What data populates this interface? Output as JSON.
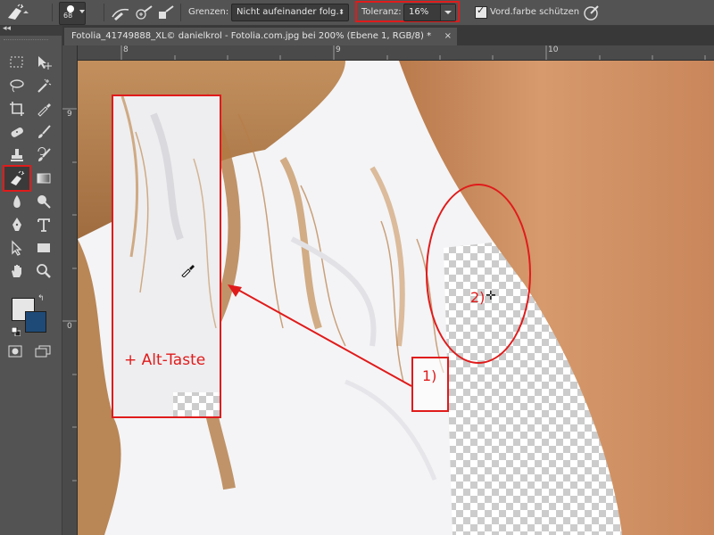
{
  "options_bar": {
    "brush_size": "68",
    "grenzen_label": "Grenzen:",
    "grenzen_value": "Nicht aufeinander folg.",
    "toleranz_label": "Toleranz:",
    "toleranz_value": "16%",
    "protect_fg_label": "Vord.farbe schützen",
    "protect_fg_checked": true
  },
  "document_tab": {
    "title": "Fotolia_41749888_XL© danielkrol - Fotolia.com.jpg bei 200% (Ebene 1, RGB/8) *",
    "close_symbol": "×"
  },
  "panel_collapse_symbol": "◂◂",
  "rulers": {
    "horizontal": [
      "8",
      "9",
      "10"
    ],
    "vertical": [
      "9",
      "0"
    ]
  },
  "toolbar": {
    "tools": [
      "marquee-icon",
      "move-icon",
      "lasso-icon",
      "magic-wand-icon",
      "crop-icon",
      "eyedropper-icon",
      "healing-brush-icon",
      "brush-icon",
      "clone-stamp-icon",
      "history-brush-icon",
      "background-eraser-icon",
      "gradient-icon",
      "blur-icon",
      "dodge-icon",
      "pen-icon",
      "type-icon",
      "path-selection-icon",
      "rectangle-shape-icon",
      "hand-icon",
      "zoom-icon"
    ],
    "active_tool": "background-eraser-icon",
    "foreground_color": "#e6e6e6",
    "background_color": "#1e4a78"
  },
  "annotations": {
    "alt_key_label": "+ Alt-Taste",
    "step1_label": "1)",
    "step2_label": "2)",
    "highlight_color": "#e01b1b"
  }
}
